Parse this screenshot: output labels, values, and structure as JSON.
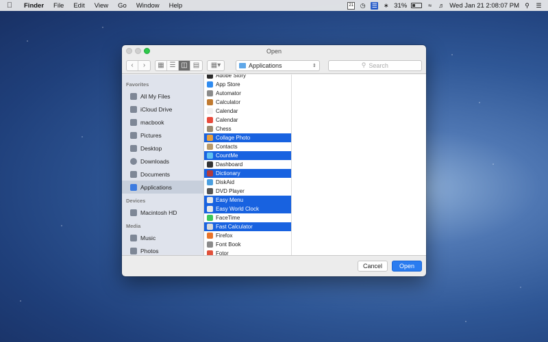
{
  "menubar": {
    "apple": "",
    "menus": [
      "Finder",
      "File",
      "Edit",
      "View",
      "Go",
      "Window",
      "Help"
    ],
    "calendar_badge": "21",
    "battery": "31%",
    "datetime": "Wed Jan 21  2:08:07 PM"
  },
  "dialog": {
    "title": "Open",
    "location": "Applications",
    "search_placeholder": "Search",
    "cancel_label": "Cancel",
    "open_label": "Open"
  },
  "sidebar": {
    "favorites_header": "Favorites",
    "favorites": [
      "All My Files",
      "iCloud Drive",
      "macbook",
      "Pictures",
      "Desktop",
      "Downloads",
      "Documents",
      "Applications"
    ],
    "devices_header": "Devices",
    "devices": [
      "Macintosh HD"
    ],
    "media_header": "Media",
    "media": [
      "Music",
      "Photos"
    ]
  },
  "apps": [
    {
      "name": "Adobe Story",
      "color": "#2b2b2b"
    },
    {
      "name": "App Store",
      "color": "#2f8bf0"
    },
    {
      "name": "Automator",
      "color": "#8a8a8a"
    },
    {
      "name": "Calculator",
      "color": "#c07a30"
    },
    {
      "name": "Calendar",
      "color": "#f0f0f0"
    },
    {
      "name": "Calendar",
      "color": "#e84b3c"
    },
    {
      "name": "Chess",
      "color": "#9b8b70"
    },
    {
      "name": "Collage Photo",
      "color": "#e7a040"
    },
    {
      "name": "Contacts",
      "color": "#b99a6a"
    },
    {
      "name": "CountMe",
      "color": "#5fc0f0"
    },
    {
      "name": "Dashboard",
      "color": "#333333"
    },
    {
      "name": "Dictionary",
      "color": "#b23b3b"
    },
    {
      "name": "DiskAid",
      "color": "#4a9fe0"
    },
    {
      "name": "DVD Player",
      "color": "#555555"
    },
    {
      "name": "Easy Menu",
      "color": "#e8e8e8"
    },
    {
      "name": "Easy World Clock",
      "color": "#e8e8e8"
    },
    {
      "name": "FaceTime",
      "color": "#3cc85a"
    },
    {
      "name": "Fast Calculator",
      "color": "#d9d9d9"
    },
    {
      "name": "Firefox",
      "color": "#e8742a"
    },
    {
      "name": "Font Book",
      "color": "#8a8a8a"
    },
    {
      "name": "Fotor",
      "color": "#e0503a"
    }
  ],
  "selected_apps": [
    "Collage Photo",
    "CountMe",
    "Dictionary",
    "Easy Menu",
    "Easy World Clock",
    "Fast Calculator"
  ]
}
